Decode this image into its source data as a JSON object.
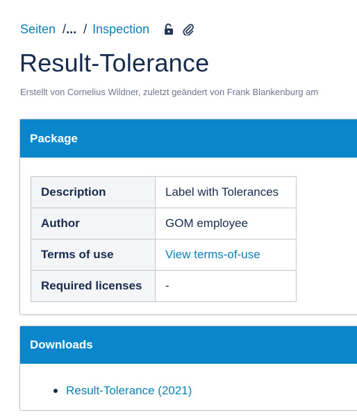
{
  "breadcrumb": {
    "items": [
      "Seiten",
      "...",
      "Inspection"
    ],
    "separator": "/",
    "icons": [
      "unlock-icon",
      "paperclip-icon"
    ]
  },
  "page": {
    "title": "Result-Tolerance",
    "byline": "Erstellt von Cornelius Wildner, zuletzt geändert von Frank Blankenburg am"
  },
  "package": {
    "header": "Package",
    "rows": [
      {
        "key": "Description",
        "value": "Label with Tolerances"
      },
      {
        "key": "Author",
        "value": "GOM employee"
      },
      {
        "key": "Terms of use",
        "value": "View terms-of-use"
      },
      {
        "key": "Required licenses",
        "value": "-"
      }
    ]
  },
  "downloads": {
    "header": "Downloads",
    "items": [
      "Result-Tolerance (2021)"
    ]
  },
  "colors": {
    "link": "#0b7fb5",
    "panel_header": "#0a87cc",
    "text": "#172b4d",
    "muted": "#6b778c"
  }
}
